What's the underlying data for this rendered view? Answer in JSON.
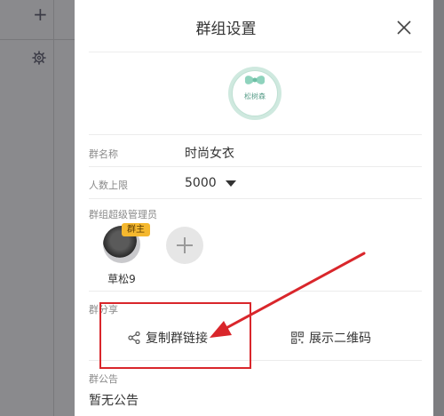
{
  "background": {
    "plus_icon": "+",
    "gear_icon": "gear-icon"
  },
  "modal": {
    "title": "群组设置",
    "close_icon": "close-icon",
    "group_logo_text": "松树森",
    "fields": {
      "group_name_label": "群名称",
      "group_name_value": "时尚女衣",
      "member_limit_label": "人数上限",
      "member_limit_value": "5000"
    },
    "admins": {
      "label": "群组超级管理员",
      "owner_badge": "群主",
      "owner_name": "草松9",
      "add_icon": "plus-icon"
    },
    "share": {
      "label": "群分享",
      "copy_link": "复制群链接",
      "show_qr": "展示二维码"
    },
    "notice": {
      "label": "群公告",
      "value": "暂无公告"
    }
  },
  "colors": {
    "annotation_red": "#d9262b",
    "badge_yellow": "#f5b82e",
    "logo_mint": "#cfe9df"
  }
}
